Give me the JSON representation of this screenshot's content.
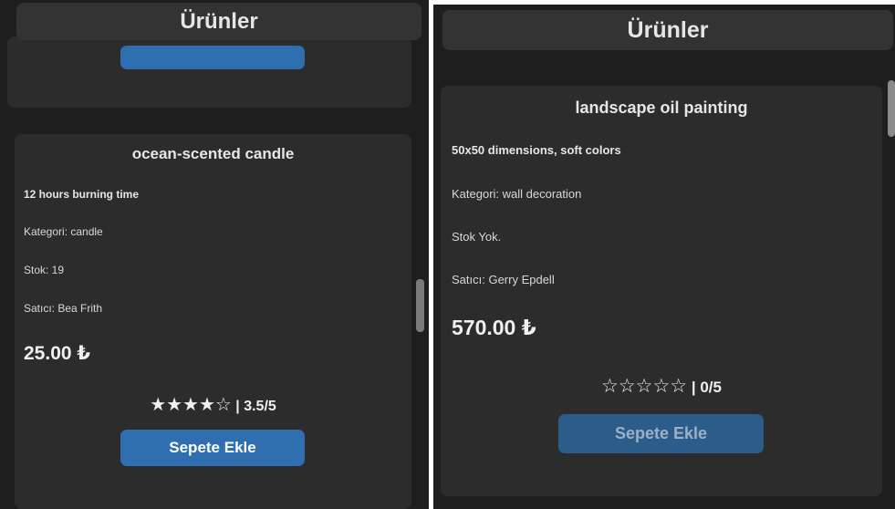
{
  "left": {
    "header_title": "Ürünler",
    "product": {
      "name": "ocean-scented candle",
      "description": "12 hours burning time",
      "category": "Kategori: candle",
      "stock": "Stok: 19",
      "seller": "Satıcı: Bea Frith",
      "price": "25.00 ₺",
      "stars": "★★★★☆",
      "rating_text": " | 3.5/5",
      "add_to_cart_label": "Sepete Ekle"
    }
  },
  "right": {
    "header_title": "Ürünler",
    "product": {
      "name": "landscape oil painting",
      "description": "50x50 dimensions, soft colors",
      "category": "Kategori: wall decoration",
      "stock": "Stok Yok.",
      "seller": "Satıcı: Gerry Epdell",
      "price": "570.00 ₺",
      "stars": "☆☆☆☆☆",
      "rating_text": " | 0/5",
      "add_to_cart_label": "Sepete Ekle"
    }
  },
  "colors": {
    "background": "#1e1e1e",
    "card": "#2c2c2c",
    "header": "#333333",
    "button": "#2f6fb0"
  }
}
